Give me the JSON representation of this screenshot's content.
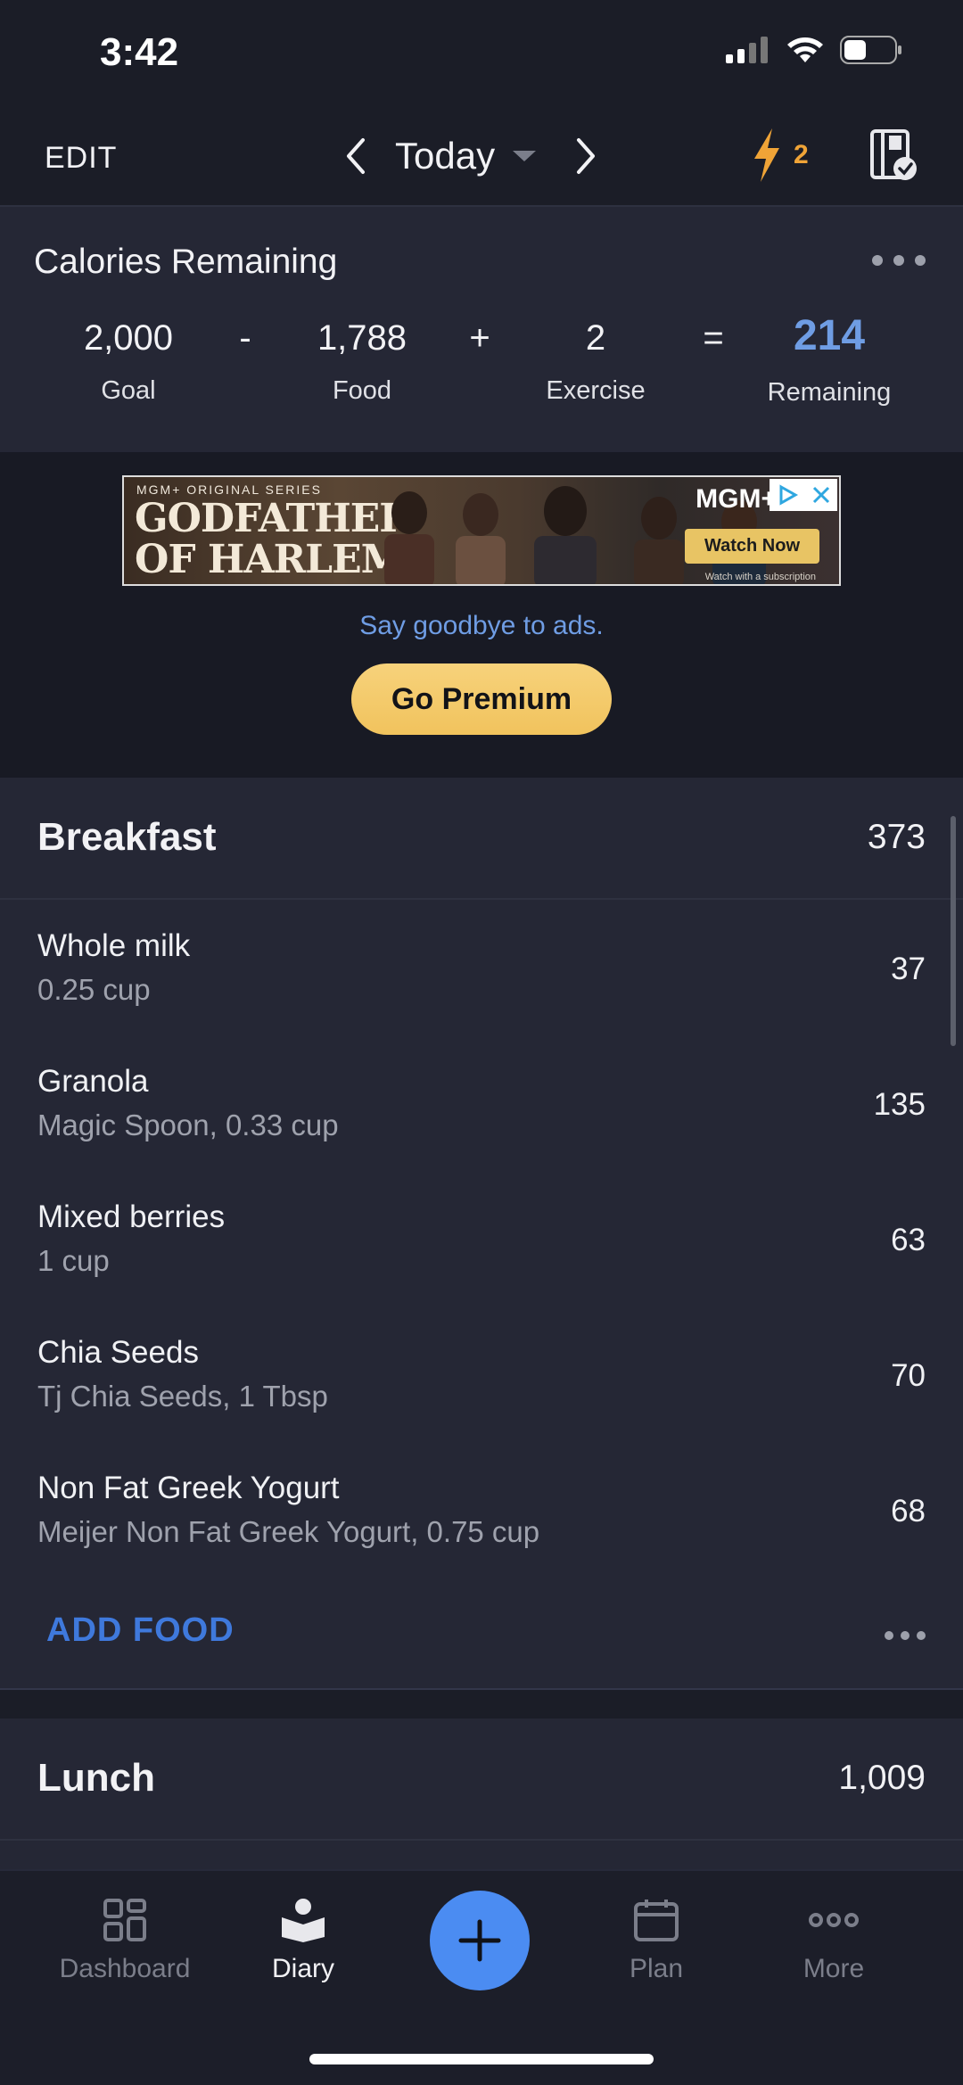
{
  "status_bar": {
    "time": "3:42"
  },
  "header": {
    "edit_label": "EDIT",
    "date_label": "Today",
    "streak_count": "2",
    "accent_color": "#f0a437"
  },
  "calories": {
    "title": "Calories Remaining",
    "goal_value": "2,000",
    "goal_label": "Goal",
    "op_minus": "-",
    "food_value": "1,788",
    "food_label": "Food",
    "op_plus": "+",
    "exercise_value": "2",
    "exercise_label": "Exercise",
    "op_equals": "=",
    "remaining_value": "214",
    "remaining_label": "Remaining",
    "remaining_color": "#6f9de4"
  },
  "ad": {
    "series_label": "MGM+ ORIGINAL SERIES",
    "title_line1": "GODFATHER",
    "title_line2": "OF HARLEM",
    "brand": "MGM+",
    "cta": "Watch Now",
    "fine_print": "Watch with a subscription",
    "remove_ads_text": "Say goodbye to ads.",
    "premium_button": "Go Premium"
  },
  "breakfast": {
    "name": "Breakfast",
    "calories": "373",
    "items": [
      {
        "name": "Whole milk",
        "desc": "0.25 cup",
        "kcal": "37"
      },
      {
        "name": "Granola",
        "desc": "Magic Spoon, 0.33 cup",
        "kcal": "135"
      },
      {
        "name": "Mixed berries",
        "desc": "1 cup",
        "kcal": "63"
      },
      {
        "name": "Chia Seeds",
        "desc": "Tj Chia Seeds, 1 Tbsp",
        "kcal": "70"
      },
      {
        "name": "Non Fat Greek Yogurt",
        "desc": "Meijer Non Fat Greek Yogurt, 0.75 cup",
        "kcal": "68"
      }
    ],
    "add_food": "ADD FOOD"
  },
  "lunch": {
    "name": "Lunch",
    "calories": "1,009"
  },
  "tabs": [
    {
      "label": "Dashboard",
      "icon": "dashboard-grid-icon"
    },
    {
      "label": "Diary",
      "icon": "diary-book-icon"
    },
    {
      "label": "Plan",
      "icon": "calendar-icon"
    },
    {
      "label": "More",
      "icon": "more-dots-icon"
    }
  ],
  "fab_icon": "plus-icon"
}
